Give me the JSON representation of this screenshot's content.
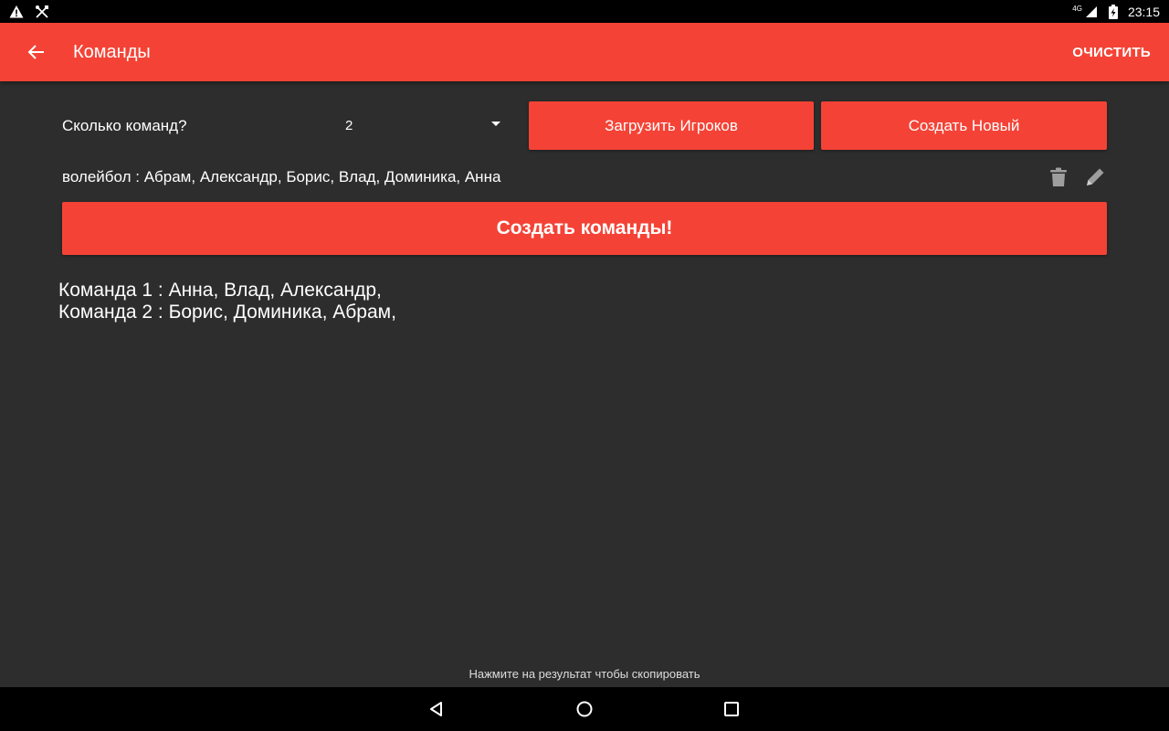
{
  "status_bar": {
    "time": "23:15",
    "network": "4G",
    "icons": [
      "warning-icon",
      "tools-icon",
      "signal-icon",
      "battery-charging-icon"
    ]
  },
  "app_bar": {
    "title": "Команды",
    "clear_label": "ОЧИСТИТЬ"
  },
  "controls": {
    "teams_label": "Сколько команд?",
    "teams_count": "2",
    "load_players_label": "Загрузить Игроков",
    "create_new_label": "Создать Новый"
  },
  "group": {
    "text": "волейбол : Абрам, Александр, Борис, Влад, Доминика, Анна"
  },
  "create_teams_label": "Создать команды!",
  "results": [
    "Команда 1 : Анна, Влад, Александр,",
    "Команда 2 : Борис, Доминика, Абрам,"
  ],
  "hint": "Нажмите на результат чтобы скопировать",
  "colors": {
    "accent": "#f44336",
    "background": "#2d2d2d",
    "bars": "#000000"
  }
}
